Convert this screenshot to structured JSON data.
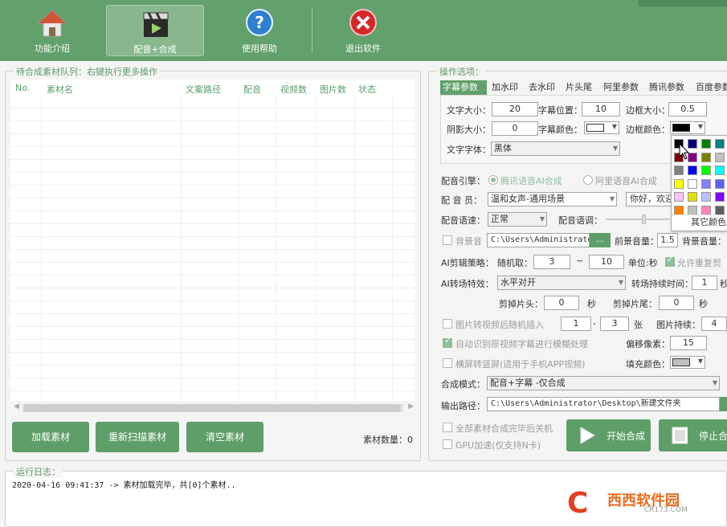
{
  "toolbar": {
    "items": [
      {
        "label": "功能介绍",
        "icon": "home-icon"
      },
      {
        "label": "配音+合成",
        "icon": "clapperboard-icon"
      },
      {
        "label": "使用帮助",
        "icon": "help-icon"
      },
      {
        "label": "退出软件",
        "icon": "exit-icon"
      }
    ],
    "active_index": 1
  },
  "queue": {
    "title": "待合成素材队列：右键执行更多操作",
    "columns": [
      "No.",
      "素材名",
      "文案路径",
      "配音",
      "视频数",
      "图片数",
      "状态"
    ],
    "rows": [],
    "buttons": {
      "load": "加载素材",
      "rescan": "重新扫描素材",
      "clear": "清空素材"
    },
    "count_label": "素材数量：0"
  },
  "options": {
    "title": "操作选项：",
    "tabs": [
      "字幕参数",
      "加水印",
      "去水印",
      "片头尾",
      "阿里参数",
      "腾讯参数",
      "百度参数"
    ],
    "active_tab": 0,
    "subtitle": {
      "font_size_label": "文字大小：",
      "font_size": "20",
      "position_label": "字幕位置：",
      "position": "10",
      "border_size_label": "边框大小：",
      "border_size": "0.5",
      "shadow_label": "阴影大小：",
      "shadow": "0",
      "color_label": "字幕颜色：",
      "color": "#ffffff",
      "border_color_label": "边框颜色：",
      "border_color": "#000000",
      "font_label": "文字字体：",
      "font": "黑体"
    },
    "palette": {
      "colors": [
        "#000000",
        "#000080",
        "#008000",
        "#008080",
        "#800000",
        "#800080",
        "#808000",
        "#c0c0c0",
        "#808080",
        "#0000ff",
        "#00ff00",
        "#00ffff",
        "#ffff00",
        "#ffffff",
        "#8080ff",
        "#6060ff",
        "#ffc0ff",
        "#e0e000",
        "#c0c0ff",
        "#8000ff",
        "#ff8000",
        "#c0c0c0",
        "#ff80c0",
        "#606060"
      ],
      "other_label": "其它颜色"
    },
    "engine_label": "配音引擎：",
    "engine_tencent": "腾讯语音AI合成",
    "engine_ali": "阿里语音AI合成",
    "voice_label": "配 音 员：",
    "voice": "温和女声-通用场景",
    "greeting": "你好，欢迎",
    "speed_label": "配音语速：",
    "speed": "正常",
    "tone_label": "配音语调：",
    "bgm_label": "背景音",
    "bgm_path": "C:\\Users\\Administrator",
    "browse": "...",
    "front_vol_label": "前景音量：",
    "front_vol": "1.5",
    "back_vol_label": "背景音量：",
    "ai_cut_label": "AI剪辑策略：",
    "random_label": "随机取：",
    "rand_min": "3",
    "dash": "~",
    "rand_max": "10",
    "unit_label": "单位:秒",
    "allow_repeat": "允许重复剪",
    "transition_label": "AI转场特效：",
    "transition": "水平对开",
    "transition_dur_label": "转场持续时间：",
    "transition_dur": "1",
    "sec": "秒",
    "cut_head_label": "剪掉片头：",
    "cut_head": "0",
    "cut_tail_label": "剪掉片尾：",
    "cut_tail": "0",
    "img2video_label": "图片转视频后随机插入",
    "img_min": "1",
    "img_dash": "-",
    "img_max": "3",
    "img_unit": "张",
    "img_dur_label": "图片持续：",
    "img_dur": "4",
    "auto_blur_label": "自动识别原视频字幕进行模糊处理",
    "offset_label": "偏移像素：",
    "offset": "15",
    "landscape_label": "横屏转竖屏(适用于手机APP视频)",
    "fill_color_label": "填充颜色：",
    "fill_color": "#c0c0c0",
    "mode_label": "合成模式：",
    "mode": "配音+字幕 -仅合成",
    "output_label": "输出路径：",
    "output": "C:\\Users\\Administrator\\Desktop\\新建文件夹",
    "shutdown_label": "全部素材合成完毕后关机",
    "gpu_label": "GPU加速(仅支持N卡)",
    "start_label": "开始合成",
    "stop_label": "停止合"
  },
  "log": {
    "title": "运行日志：",
    "lines": [
      "2020-04-16 09:41:37 -> 素材加载完毕，共[0]个素材.."
    ]
  },
  "watermark": {
    "logo": "C",
    "main": "西西软件园",
    "sub": "CR173.COM"
  }
}
